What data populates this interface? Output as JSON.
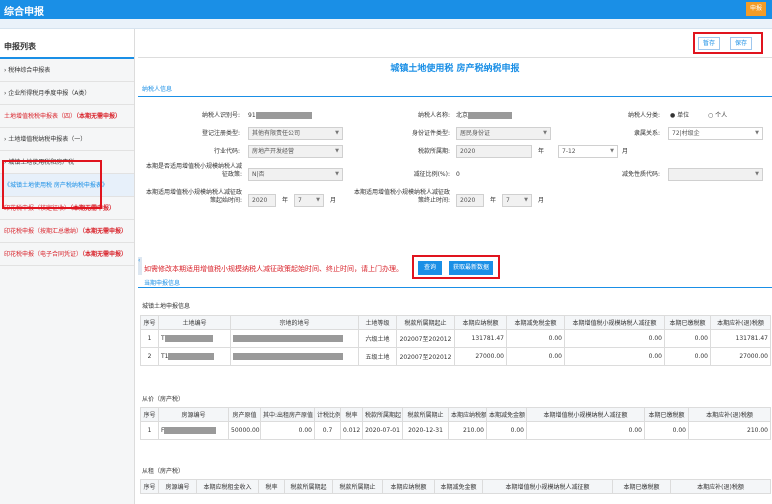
{
  "topbar": {
    "title": "综合申报",
    "button": "申报"
  },
  "sidebar": {
    "title": "申报列表",
    "items": [
      {
        "label": "› 税种综合申报表",
        "note": ""
      },
      {
        "label": "› 企业所得税月季度申报（A类）",
        "note": ""
      },
      {
        "label": "土地增值税税申报表（四）",
        "note": "（本期无需申报）"
      },
      {
        "label": "› 土地增值税纳税申报表（一）",
        "note": ""
      },
      {
        "label": "› 城镇土地使用税和房产税",
        "note": ""
      },
      {
        "label": "《城镇土地使用税 房产税纳税申报表》",
        "note": ""
      },
      {
        "label": "印花税申报（核定征收）",
        "note": "（本期无需申报）"
      },
      {
        "label": "印花税申报（按期汇总缴纳）",
        "note": "（本期无需申报）"
      },
      {
        "label": "印花税申报（电子合同凭证）",
        "note": "（本期无需申报）"
      }
    ]
  },
  "toolbar": {
    "pause": "暂存",
    "save": "保存"
  },
  "form": {
    "title": "城镇土地使用税 房产税纳税申报",
    "tab": "纳税人信息",
    "taxpayer_id_label": "纳税人识别号:",
    "taxpayer_id_value": "91",
    "taxpayer_name_label": "纳税人名称:",
    "taxpayer_name_value": "北京",
    "taxpayer_type_label": "纳税人分类:",
    "type_unit": "单位",
    "type_person": "个人",
    "reg_type_label": "登记注册类型:",
    "reg_type_value": "其他有限责任公司",
    "id_type_label": "身份证件类型:",
    "id_type_value": "居民身份证",
    "affiliation_label": "隶属关系:",
    "affiliation_value": "72|村级企",
    "industry_label": "行业代码:",
    "industry_value": "房地产开发经营",
    "period_label": "税款所属期:",
    "period_year": "2020",
    "year_unit": "年",
    "period_month": "7-12",
    "month_unit": "月",
    "small_policy_label": "本期是否适用增值税小规模纳税人减征政策:",
    "small_policy_value": "N|否",
    "reduce_ratio_label": "减征比例(%):",
    "reduce_ratio_value": "0",
    "exempt_code_label": "减免性质代码:",
    "start_label": "本期适用增值税小规模纳税人减征政策起始时间:",
    "start_year": "2020",
    "start_month": "7",
    "end_label": "本期适用增值税小规模纳税人减征政策终止时间:",
    "end_year": "2020",
    "end_month": "7"
  },
  "notice": "如需修改本期适用增值税小规模纳税人减征政策起始时间、终止时间，请上门办理。",
  "actions": {
    "query": "查询",
    "fetch": "获取最新数据"
  },
  "current_tab": "当期申报信息",
  "land": {
    "title": "城镇土地申报信息",
    "headers": [
      "序号",
      "土地编号",
      "宗地的地号",
      "土地等级",
      "税款所属期起止",
      "本期应纳税额",
      "本期减免税金额",
      "本期增值税小规模纳税人减征额",
      "本期已缴税额",
      "本期应补(退)税额"
    ],
    "rows": [
      [
        "1",
        "T",
        "",
        "六级土地",
        "202007至202012",
        "131781.47",
        "0.00",
        "0.00",
        "0.00",
        "131781.47"
      ],
      [
        "2",
        "T1",
        "",
        "五级土地",
        "202007至202012",
        "27000.00",
        "0.00",
        "0.00",
        "0.00",
        "27000.00"
      ]
    ]
  },
  "valued": {
    "title": "从价（房产税）",
    "headers": [
      "序号",
      "房源编号",
      "房产原值",
      "其中:出租房产原值",
      "计税比例",
      "税率",
      "税款所属期起",
      "税款所属期止",
      "本期应纳税额",
      "本期减免金额",
      "本期增值税小规模纳税人减征额",
      "本期已缴税额",
      "本期应补(退)税额"
    ],
    "rows": [
      [
        "1",
        "F",
        "50000.00",
        "0.00",
        "0.7",
        "0.012",
        "2020-07-01",
        "2020-12-31",
        "210.00",
        "0.00",
        "0.00",
        "0.00",
        "210.00"
      ]
    ]
  },
  "rental": {
    "title": "从租（房产税）",
    "headers": [
      "序号",
      "房源编号",
      "本期应税租金收入",
      "税率",
      "税款所属期起",
      "税款所属期止",
      "本期应纳税额",
      "本期减免金额",
      "本期增值税小规模纳税人减征额",
      "本期已缴税额",
      "本期应补(退)税额"
    ]
  }
}
